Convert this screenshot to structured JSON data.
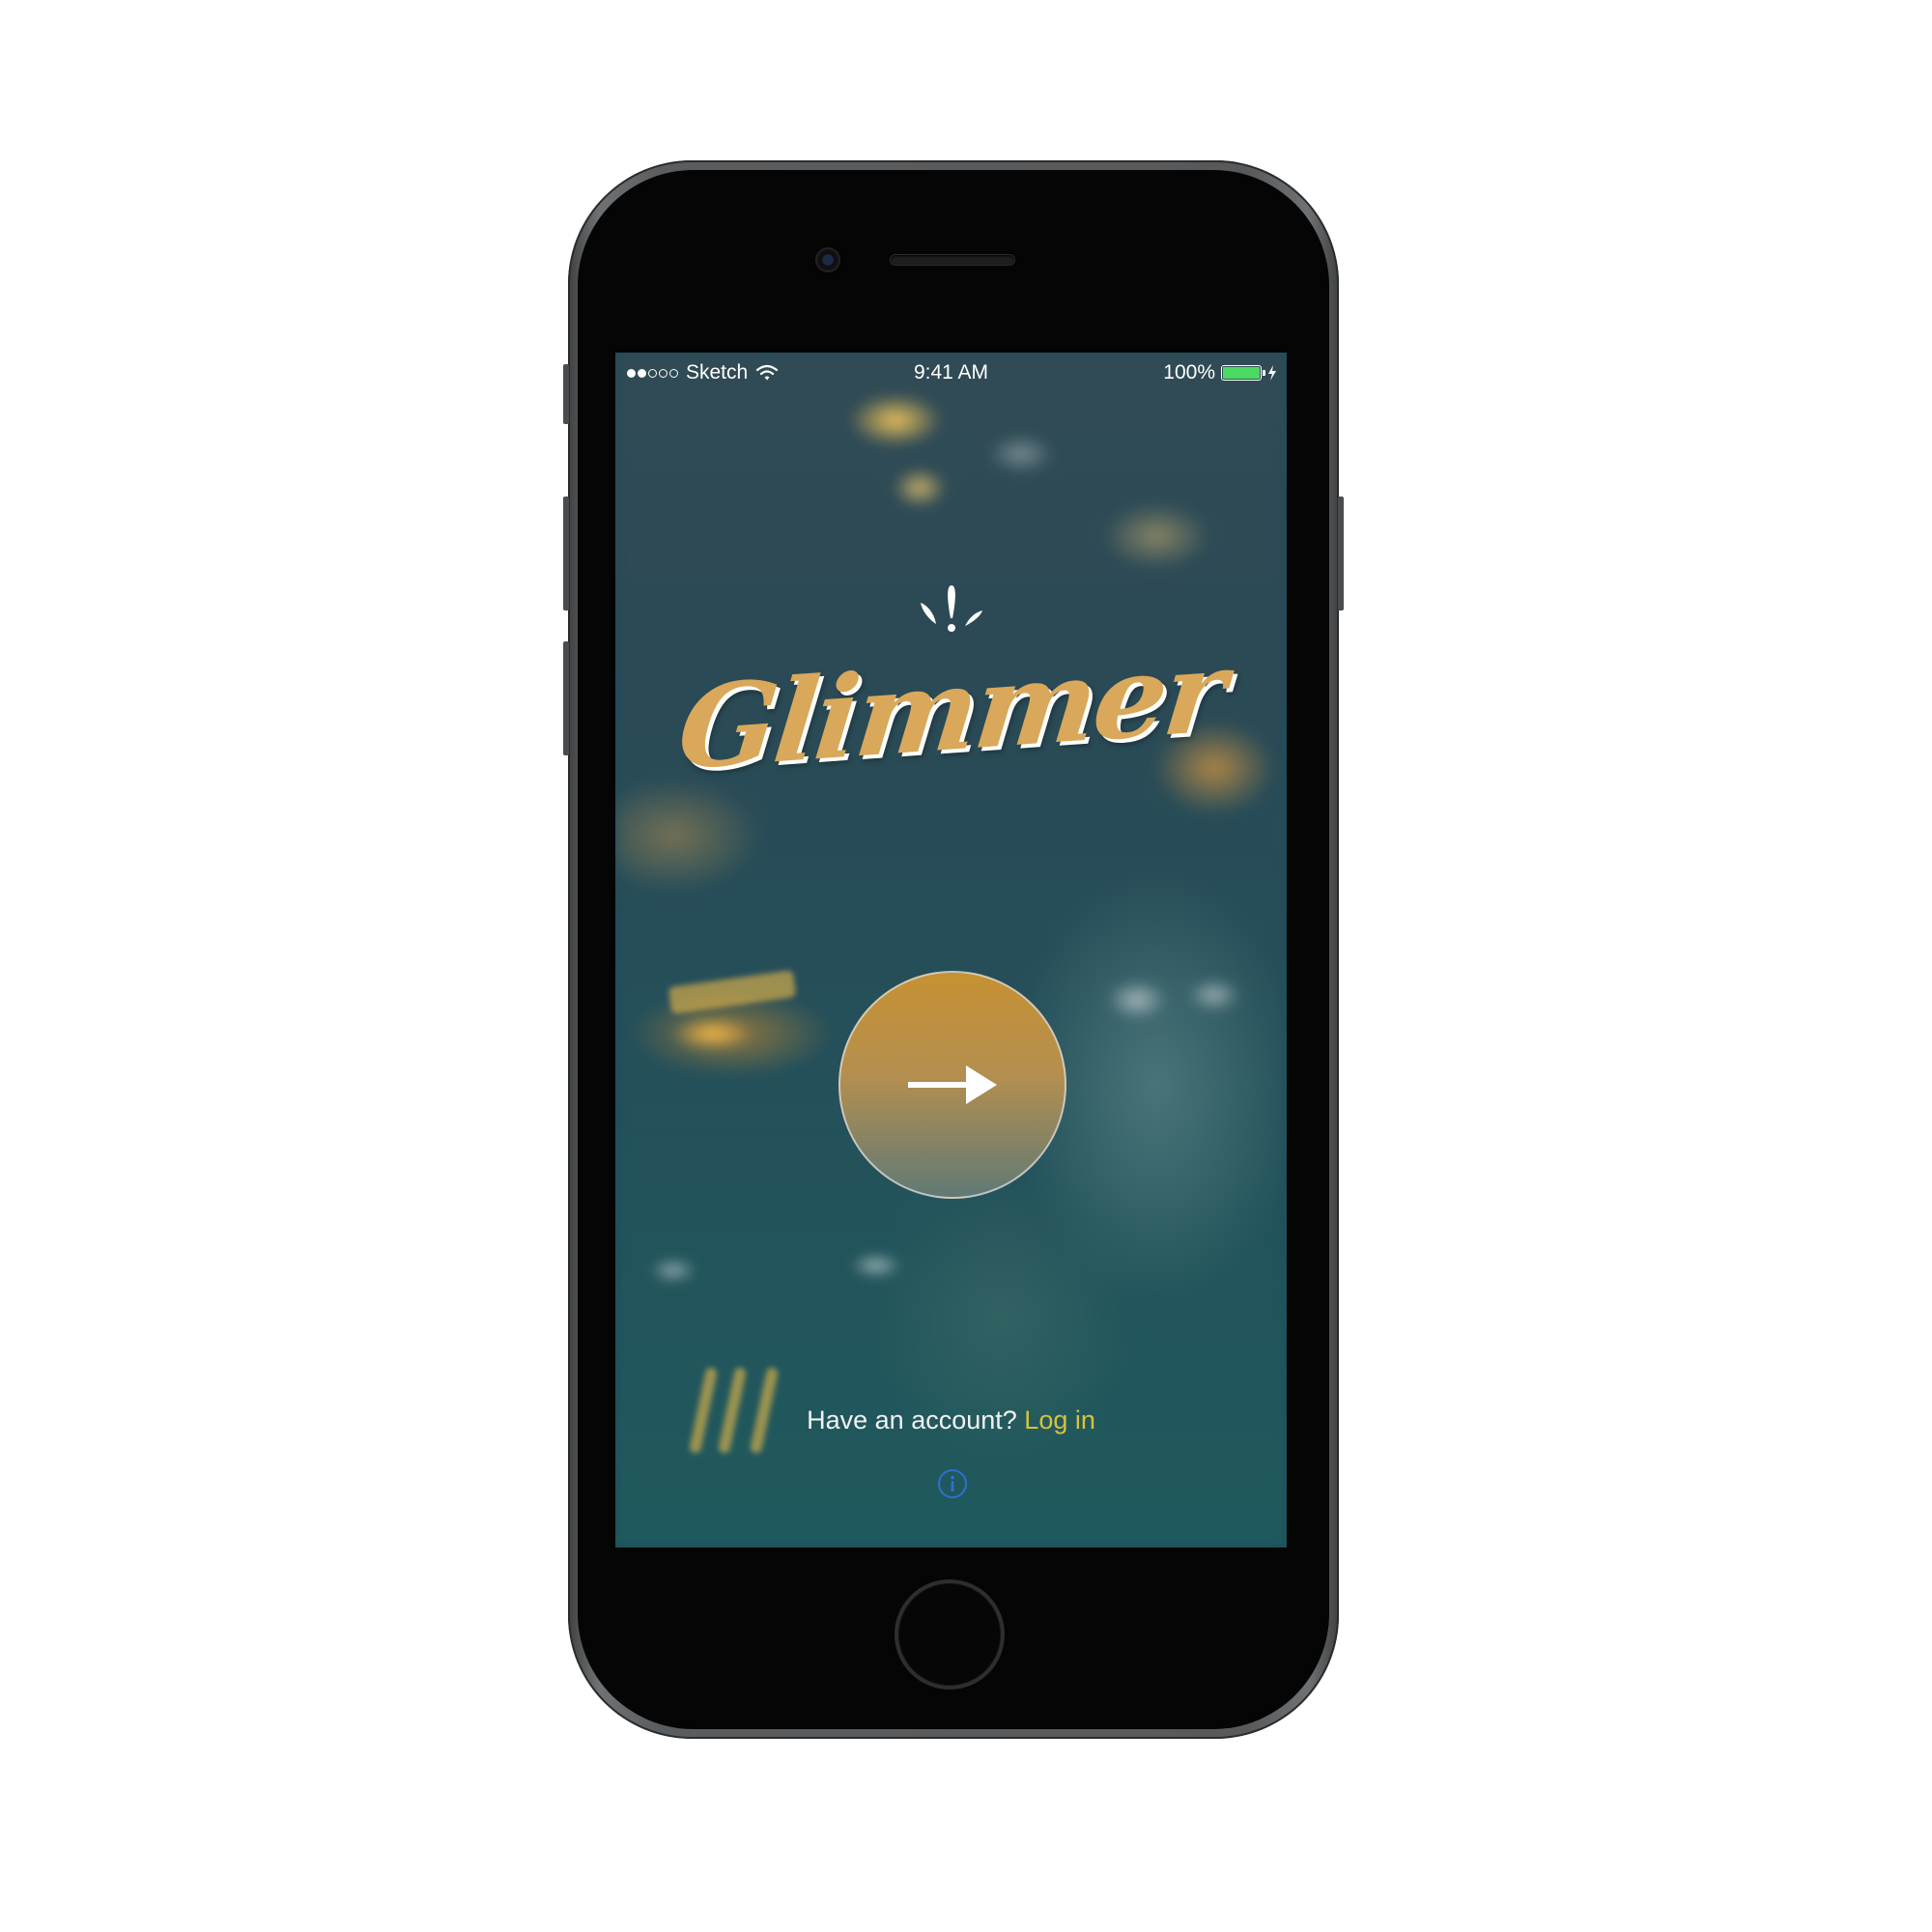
{
  "status_bar": {
    "carrier": "Sketch",
    "time": "9:41 AM",
    "battery_percent": "100%",
    "signal_bars_filled": 2,
    "signal_bars_total": 5,
    "battery_level": 1.0
  },
  "logo": {
    "text": "Glimmer",
    "mark_icon": "sparkle-drops-icon"
  },
  "main": {
    "continue_icon": "arrow-right-icon"
  },
  "footer": {
    "prompt": "Have an account?",
    "login_link": "Log in",
    "info_icon": "info-icon"
  },
  "colors": {
    "brand_gold": "#d9a85a",
    "link_yellow": "#d8c23c",
    "battery_green": "#4cd964",
    "info_blue": "#2f6fd3"
  }
}
